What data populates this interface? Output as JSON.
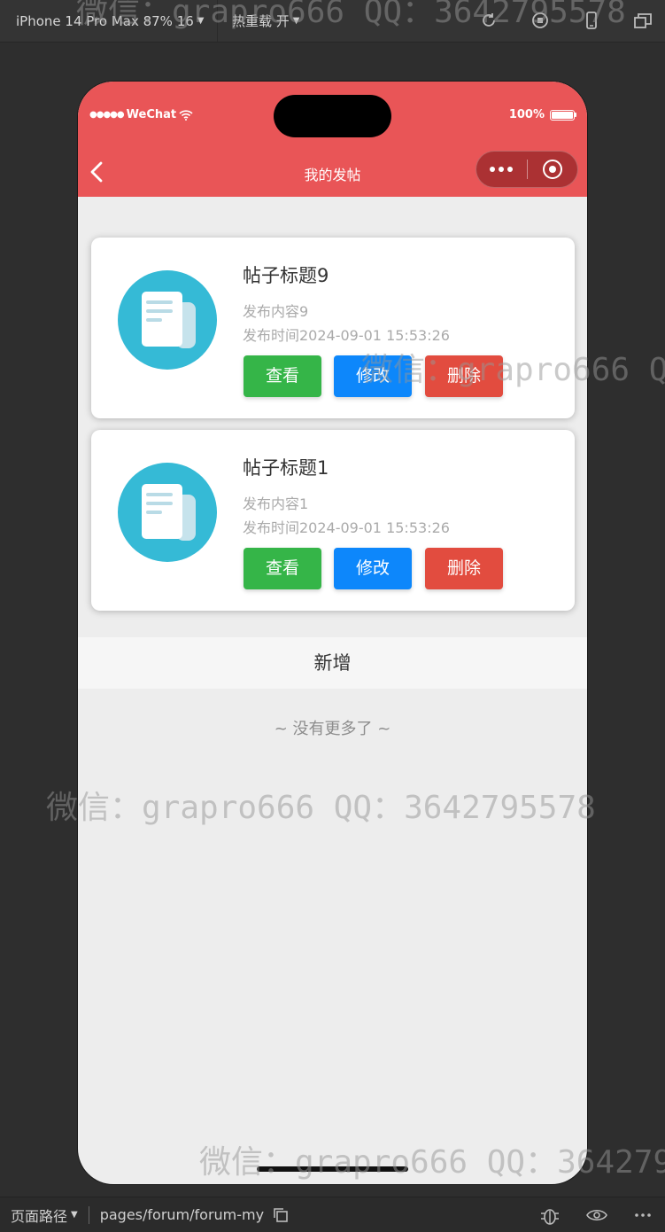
{
  "devtools": {
    "device": "iPhone 14 Pro Max 87% 16",
    "hot_reload": "热重载 开"
  },
  "status_bar": {
    "carrier": "WeChat",
    "battery": "100%"
  },
  "navbar": {
    "title": "我的发帖"
  },
  "posts": [
    {
      "title": "帖子标题9",
      "content": "发布内容9",
      "time": "发布时间2024-09-01 15:53:26"
    },
    {
      "title": "帖子标题1",
      "content": "发布内容1",
      "time": "发布时间2024-09-01 15:53:26"
    }
  ],
  "actions": {
    "view": "查看",
    "edit": "修改",
    "delete": "删除"
  },
  "add_button": "新增",
  "no_more": "~ 没有更多了 ~",
  "watermark": "微信：grapro666 QQ：3642795578",
  "bottom_bar": {
    "path_label": "页面路径",
    "path": "pages/forum/forum-my"
  },
  "colors": {
    "header": "#e95557",
    "view": "#35b548",
    "edit": "#0d87fb",
    "delete": "#e24c3f",
    "avatar": "#35bad6"
  }
}
